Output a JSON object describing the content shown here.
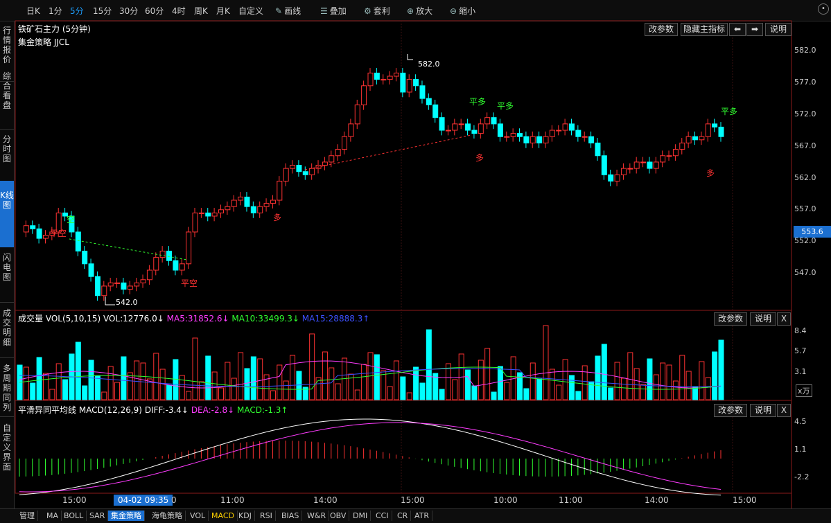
{
  "toolbar": {
    "periods": [
      "日K",
      "1分",
      "5分",
      "15分",
      "30分",
      "60分",
      "4时",
      "周K",
      "月K",
      "自定义"
    ],
    "active_period": "5分",
    "tools": [
      {
        "icon": "pencil-icon",
        "label": "画线"
      },
      {
        "icon": "layers-icon",
        "label": "叠加"
      },
      {
        "icon": "gear-icon",
        "label": "套利"
      },
      {
        "icon": "zoom-in-icon",
        "label": "放大"
      },
      {
        "icon": "zoom-out-icon",
        "label": "缩小"
      }
    ]
  },
  "sidebar": {
    "items": [
      "行情报价",
      "综合看盘",
      "分时图",
      "K线图",
      "闪电图",
      "成交明细",
      "多周期同列",
      "自定义界面"
    ],
    "active": "K线图"
  },
  "main_chart": {
    "title": "铁矿石主力 (5分钟)",
    "strategy": "集金策略 JJCL",
    "buttons": {
      "params": "改参数",
      "hide": "隐藏主指标",
      "explain": "说明"
    },
    "current_price": "553.6",
    "high_label": "582.0",
    "low_label": "542.0",
    "y_ticks": [
      "582.0",
      "577.0",
      "572.0",
      "567.0",
      "562.0",
      "557.0",
      "552.0",
      "547.0"
    ],
    "signals": [
      "平多",
      "平多",
      "平多",
      "多",
      "多",
      "多",
      "平空",
      "空",
      "平空"
    ]
  },
  "volume": {
    "title": "成交量",
    "indicator": "VOL(5,10,15)",
    "vol": "VOL:12776.0↓",
    "ma5": "MA5:31852.6↓",
    "ma10": "MA10:33499.3↓",
    "ma15": "MA15:28888.3↑",
    "buttons": {
      "params": "改参数",
      "explain": "说明",
      "close": "X"
    },
    "y_ticks": [
      "8.4",
      "5.7",
      "3.1"
    ],
    "unit": "x万"
  },
  "macd": {
    "title": "平滑异同平均线",
    "indicator": "MACD(12,26,9)",
    "diff": "DIFF:-3.4↓",
    "dea": "DEA:-2.8↓",
    "macd": "MACD:-1.3↑",
    "buttons": {
      "params": "改参数",
      "explain": "说明",
      "close": "X"
    },
    "y_ticks": [
      "4.5",
      "1.1",
      "-2.2"
    ]
  },
  "x_axis": {
    "labels": [
      "15:00",
      "11:00",
      "14:00",
      "15:00",
      "10:00",
      "11:00",
      "14:00",
      "15:00"
    ],
    "cursor": "04-02 09:35",
    "cursor_tail": "0"
  },
  "bottom_tabs": [
    "管理",
    "MA",
    "BOLL",
    "SAR",
    "集金策略",
    "海龟策略",
    "VOL",
    "MACD",
    "KDJ",
    "RSI",
    "BIAS",
    "W&R",
    "OBV",
    "DMI",
    "CCI",
    "CR",
    "ATR"
  ],
  "bottom_active": "集金策略",
  "bottom_yellow": "MACD",
  "colors": {
    "up": "#ff3232",
    "down": "#00ffff",
    "ma5": "#ff00ff",
    "ma10": "#00ff00",
    "ma15": "#3c50ff",
    "accent": "#1b6fd0"
  }
}
